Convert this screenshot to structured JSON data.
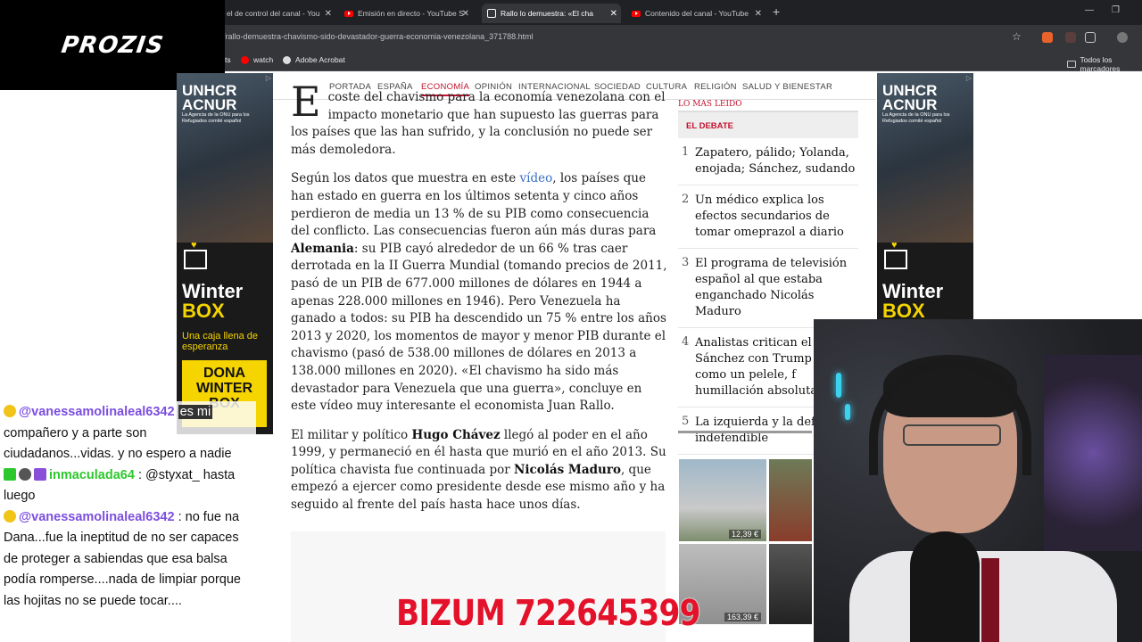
{
  "browser": {
    "tabs": [
      {
        "label": "el de control del canal - You",
        "icon": "youtube-icon"
      },
      {
        "label": "Emisión en directo - YouTube S",
        "icon": "youtube-icon"
      },
      {
        "label": "Rallo lo demuestra: «El cha",
        "icon": "news-icon"
      },
      {
        "label": "Contenido del canal - YouTube",
        "icon": "youtube-icon"
      }
    ],
    "url": "/rallo-demuestra-chavismo-sido-devastador-guerra-economia-venezolana_371788.html",
    "bookmarks": [
      "ts",
      "watch",
      "Adobe Acrobat"
    ],
    "bookmarks_right": "Todos los marcadores"
  },
  "overlay": {
    "logo": "PROZIS",
    "bizum": "BIZUM 722645399"
  },
  "site_nav": [
    "PORTADA",
    "ESPAÑA",
    "ECONOMÍA",
    "OPINIÓN",
    "INTERNACIONAL",
    "SOCIEDAD",
    "CULTURA",
    "RELIGIÓN",
    "SALUD Y BIENESTAR"
  ],
  "article": {
    "p1_drop": "E",
    "p1": "coste del chavismo para la economía venezolana con el impacto monetario que han supuesto las guerras para los países que las han sufrido, y la conclusión no puede ser más demoledora.",
    "p2_a": "Según los datos que muestra en este ",
    "p2_link": "vídeo",
    "p2_b": ", los países que han estado en guerra en los últimos setenta y cinco años perdieron de media un 13 % de su PIB como consecuencia del conflicto. Las consecuencias fueron aún más duras para ",
    "p2_bold": "Alemania",
    "p2_c": ": su PIB cayó alrededor de un 66 % tras caer derrotada en la II Guerra Mundial (tomando precios de 2011, pasó de un PIB de 677.000 millones de dólares en 1944 a apenas 228.000 millones en 1946). Pero Venezuela ha ganado a todos: su PIB ha descendido un 75 % entre los años 2013 y 2020, los momentos de mayor y menor PIB durante el chavismo (pasó de 538.00 millones de dólares en 2013 a 138.000 millones en 2020). «El chavismo ha sido más devastador para Venezuela que una guerra», concluye en este vídeo muy interesante el economista Juan Rallo.",
    "p3_a": "El militar y político ",
    "p3_bold1": "Hugo Chávez",
    "p3_b": " llegó al poder en el año 1999, y permaneció en él hasta que murió en el año 2013. Su política chavista fue continuada por ",
    "p3_bold2": "Nicolás Maduro",
    "p3_c": ", que empezó a ejercer como presidente desde ese mismo año y ha seguido al frente del país hasta hace unos días."
  },
  "sidebar": {
    "cut_heading": "LO MÁS LEÍDO",
    "section": "EL DEBATE",
    "items": [
      {
        "num": "1",
        "text": "Zapatero, pálido; Yolanda, enojada; Sánchez, sudando"
      },
      {
        "num": "2",
        "text": "Un médico explica los efectos secundarios de tomar omeprazol a diario"
      },
      {
        "num": "3",
        "text": "El programa de televisión español al que estaba enganchado Nicolás Maduro"
      },
      {
        "num": "4",
        "text": "Analistas critican el en de Sánchez con Trump trató como un pelele, f humillación absoluta»"
      },
      {
        "num": "5",
        "text": "La izquierda y la defen indefendible"
      }
    ],
    "products": [
      {
        "price": "12,39 €"
      },
      {
        "price": "163,39 €"
      }
    ]
  },
  "ads": {
    "brand": "UNHCR ACNUR",
    "subtitle": "La Agencia de la ONU para los Refugiados comité español",
    "winter": "Winter",
    "box": "BOX",
    "tagline": "Una caja llena de esperanza",
    "cta": "DONA WINTER BOX"
  },
  "chat": [
    {
      "user": "@vanessamolinaleal6342",
      "user_color": "#7c4ee0",
      "highlight": "es mi",
      "text": "compañero y a parte son ciudadanos...vidas. y no espero a nadie"
    },
    {
      "user": "inmaculada64",
      "user_color": "#2ec82e",
      "text": ": @styxat_ hasta luego"
    },
    {
      "user": "@vanessamolinaleal6342",
      "user_color": "#7c4ee0",
      "text": ": no fue na Dana...fue la ineptitud de no ser capaces de proteger a sabiendas que esa balsa podía romperse....nada de limpiar porque las hojitas no se puede tocar...."
    }
  ],
  "colors": {
    "accent": "#c4122f",
    "link": "#3a6fc4",
    "bizum": "#e3122a",
    "ad_yellow": "#f5d400"
  }
}
